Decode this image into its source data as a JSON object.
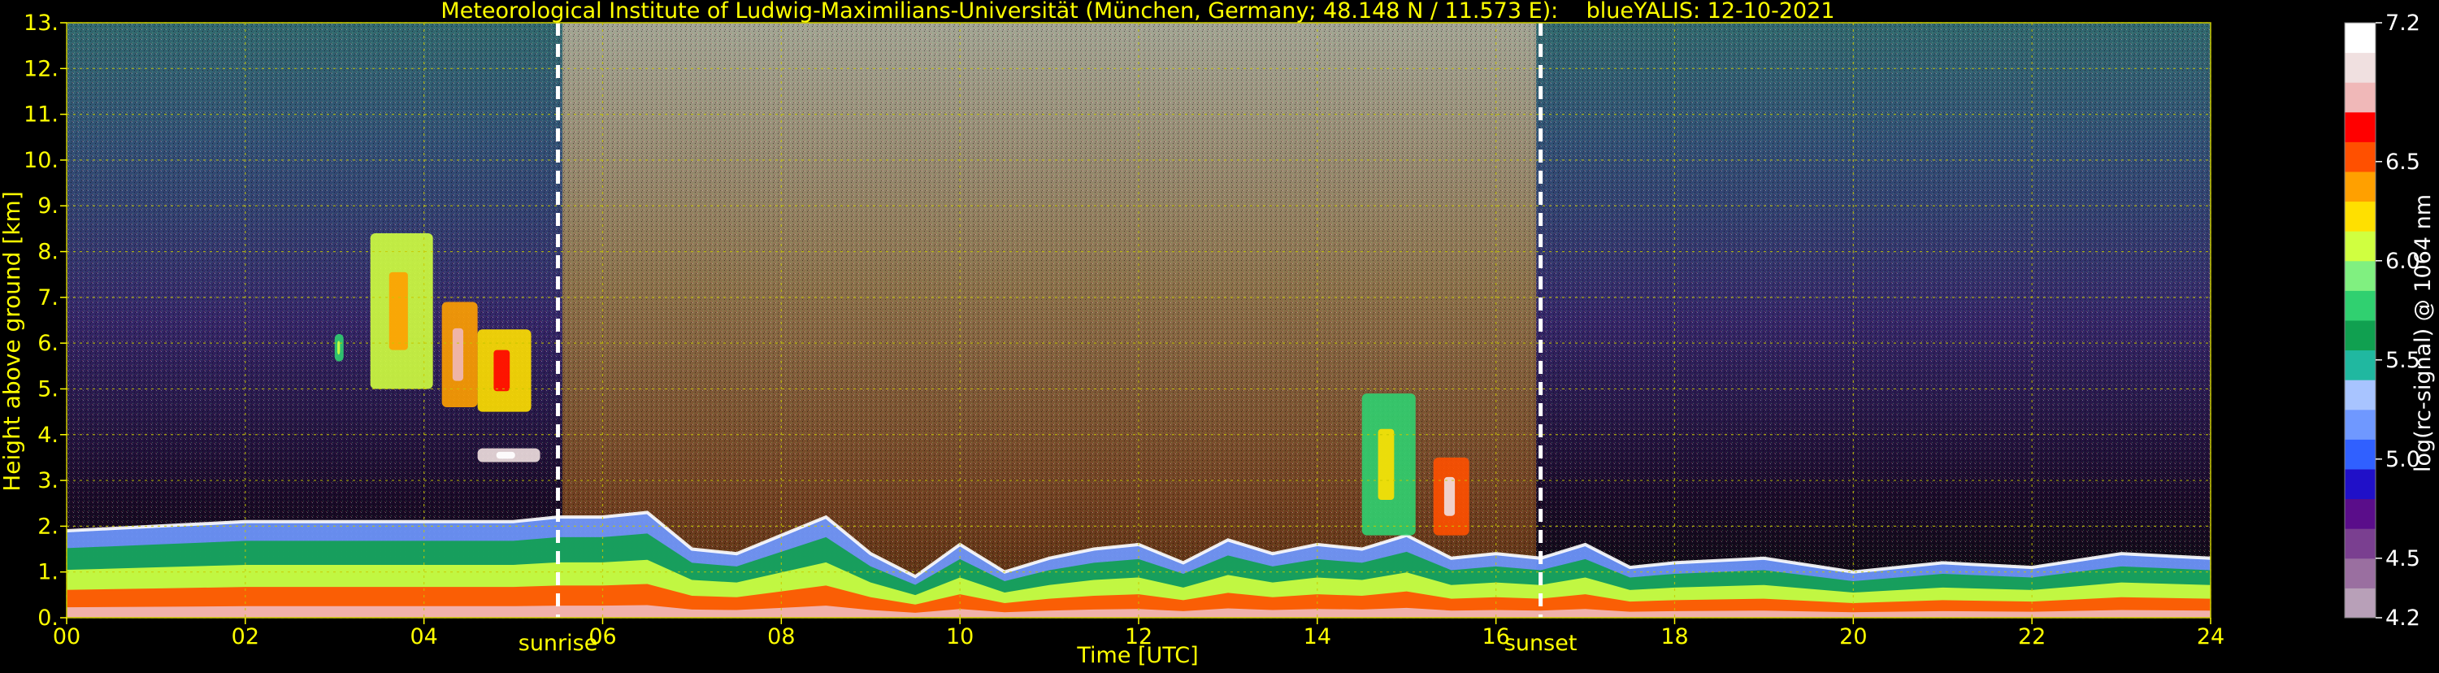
{
  "chart_data": {
    "type": "heatmap",
    "title": "Meteorological Institute of Ludwig-Maximilians-Universität (München, Germany; 48.148 N / 11.573 E):    blueYALIS: 12-10-2021",
    "xlabel": "Time [UTC]",
    "ylabel": "Height above ground [km]",
    "colorbar_label": "log(rc-signal) @ 1064 nm",
    "xlim": [
      0,
      24
    ],
    "ylim": [
      0,
      13
    ],
    "x_ticks": [
      0,
      2,
      4,
      6,
      8,
      10,
      12,
      14,
      16,
      18,
      20,
      22,
      24
    ],
    "x_tick_labels": [
      "00",
      "02",
      "04",
      "06",
      "08",
      "10",
      "12",
      "14",
      "16",
      "18",
      "20",
      "22",
      "24"
    ],
    "y_ticks": [
      0,
      1,
      2,
      3,
      4,
      5,
      6,
      7,
      8,
      9,
      10,
      11,
      12,
      13
    ],
    "y_tick_labels": [
      "0.",
      "1.",
      "2.",
      "3.",
      "4.",
      "5.",
      "6.",
      "7.",
      "8.",
      "9.",
      "10.",
      "11.",
      "12.",
      "13."
    ],
    "colorbar_range": [
      4.2,
      7.2
    ],
    "colorbar_ticks": [
      4.2,
      4.5,
      5.0,
      5.5,
      6.0,
      6.5,
      7.2
    ],
    "colorbar_tick_labels": [
      "4.2",
      "4.5",
      "5.0",
      "5.5",
      "6.0",
      "6.5",
      "7.2"
    ],
    "colormap": [
      "#b8a0b8",
      "#9a6fa0",
      "#7a3f90",
      "#5a0d8a",
      "#2010c8",
      "#3060ff",
      "#6f98ff",
      "#a8c4ff",
      "#20b8a0",
      "#10a050",
      "#30d070",
      "#80f080",
      "#d0ff40",
      "#ffe000",
      "#ffa000",
      "#ff5000",
      "#ff0000",
      "#f0b8b8",
      "#f0e0e0",
      "#ffffff"
    ],
    "grid": true,
    "grid_color": "#c8c800",
    "text_color": "#ffff00",
    "annotations": [
      {
        "text": "sunrise",
        "x": 5.5
      },
      {
        "text": "sunset",
        "x": 16.5
      }
    ],
    "boundary_layer_top_km": [
      [
        0,
        1.9
      ],
      [
        1,
        2.0
      ],
      [
        2,
        2.1
      ],
      [
        3,
        2.1
      ],
      [
        4,
        2.1
      ],
      [
        5,
        2.1
      ],
      [
        5.5,
        2.2
      ],
      [
        6,
        2.2
      ],
      [
        6.5,
        2.3
      ],
      [
        7,
        1.5
      ],
      [
        7.5,
        1.4
      ],
      [
        8,
        1.8
      ],
      [
        8.5,
        2.2
      ],
      [
        9,
        1.4
      ],
      [
        9.5,
        0.9
      ],
      [
        10,
        1.6
      ],
      [
        10.5,
        1.0
      ],
      [
        11,
        1.3
      ],
      [
        11.5,
        1.5
      ],
      [
        12,
        1.6
      ],
      [
        12.5,
        1.2
      ],
      [
        13,
        1.7
      ],
      [
        13.5,
        1.4
      ],
      [
        14,
        1.6
      ],
      [
        14.5,
        1.5
      ],
      [
        15,
        1.8
      ],
      [
        15.5,
        1.3
      ],
      [
        16,
        1.4
      ],
      [
        16.5,
        1.3
      ],
      [
        17,
        1.6
      ],
      [
        17.5,
        1.1
      ],
      [
        18,
        1.2
      ],
      [
        19,
        1.3
      ],
      [
        20,
        1.0
      ],
      [
        21,
        1.2
      ],
      [
        22,
        1.1
      ],
      [
        23,
        1.4
      ],
      [
        24,
        1.3
      ]
    ],
    "cloud_layers": [
      {
        "x_start": 3.0,
        "x_end": 3.1,
        "z_bottom": 5.6,
        "z_top": 6.2,
        "value": 5.7
      },
      {
        "x_start": 3.4,
        "x_end": 4.1,
        "z_bottom": 5.0,
        "z_top": 8.4,
        "value": 6.0
      },
      {
        "x_start": 4.2,
        "x_end": 4.6,
        "z_bottom": 4.6,
        "z_top": 6.9,
        "value": 6.4
      },
      {
        "x_start": 4.6,
        "x_end": 5.2,
        "z_bottom": 4.5,
        "z_top": 6.3,
        "value": 6.2
      },
      {
        "x_start": 4.6,
        "x_end": 5.3,
        "z_bottom": 3.4,
        "z_top": 3.7,
        "value": 7.0
      },
      {
        "x_start": 14.5,
        "x_end": 15.1,
        "z_bottom": 1.8,
        "z_top": 4.9,
        "value": 5.8
      },
      {
        "x_start": 15.3,
        "x_end": 15.7,
        "z_bottom": 1.8,
        "z_top": 3.5,
        "value": 6.5
      }
    ]
  }
}
